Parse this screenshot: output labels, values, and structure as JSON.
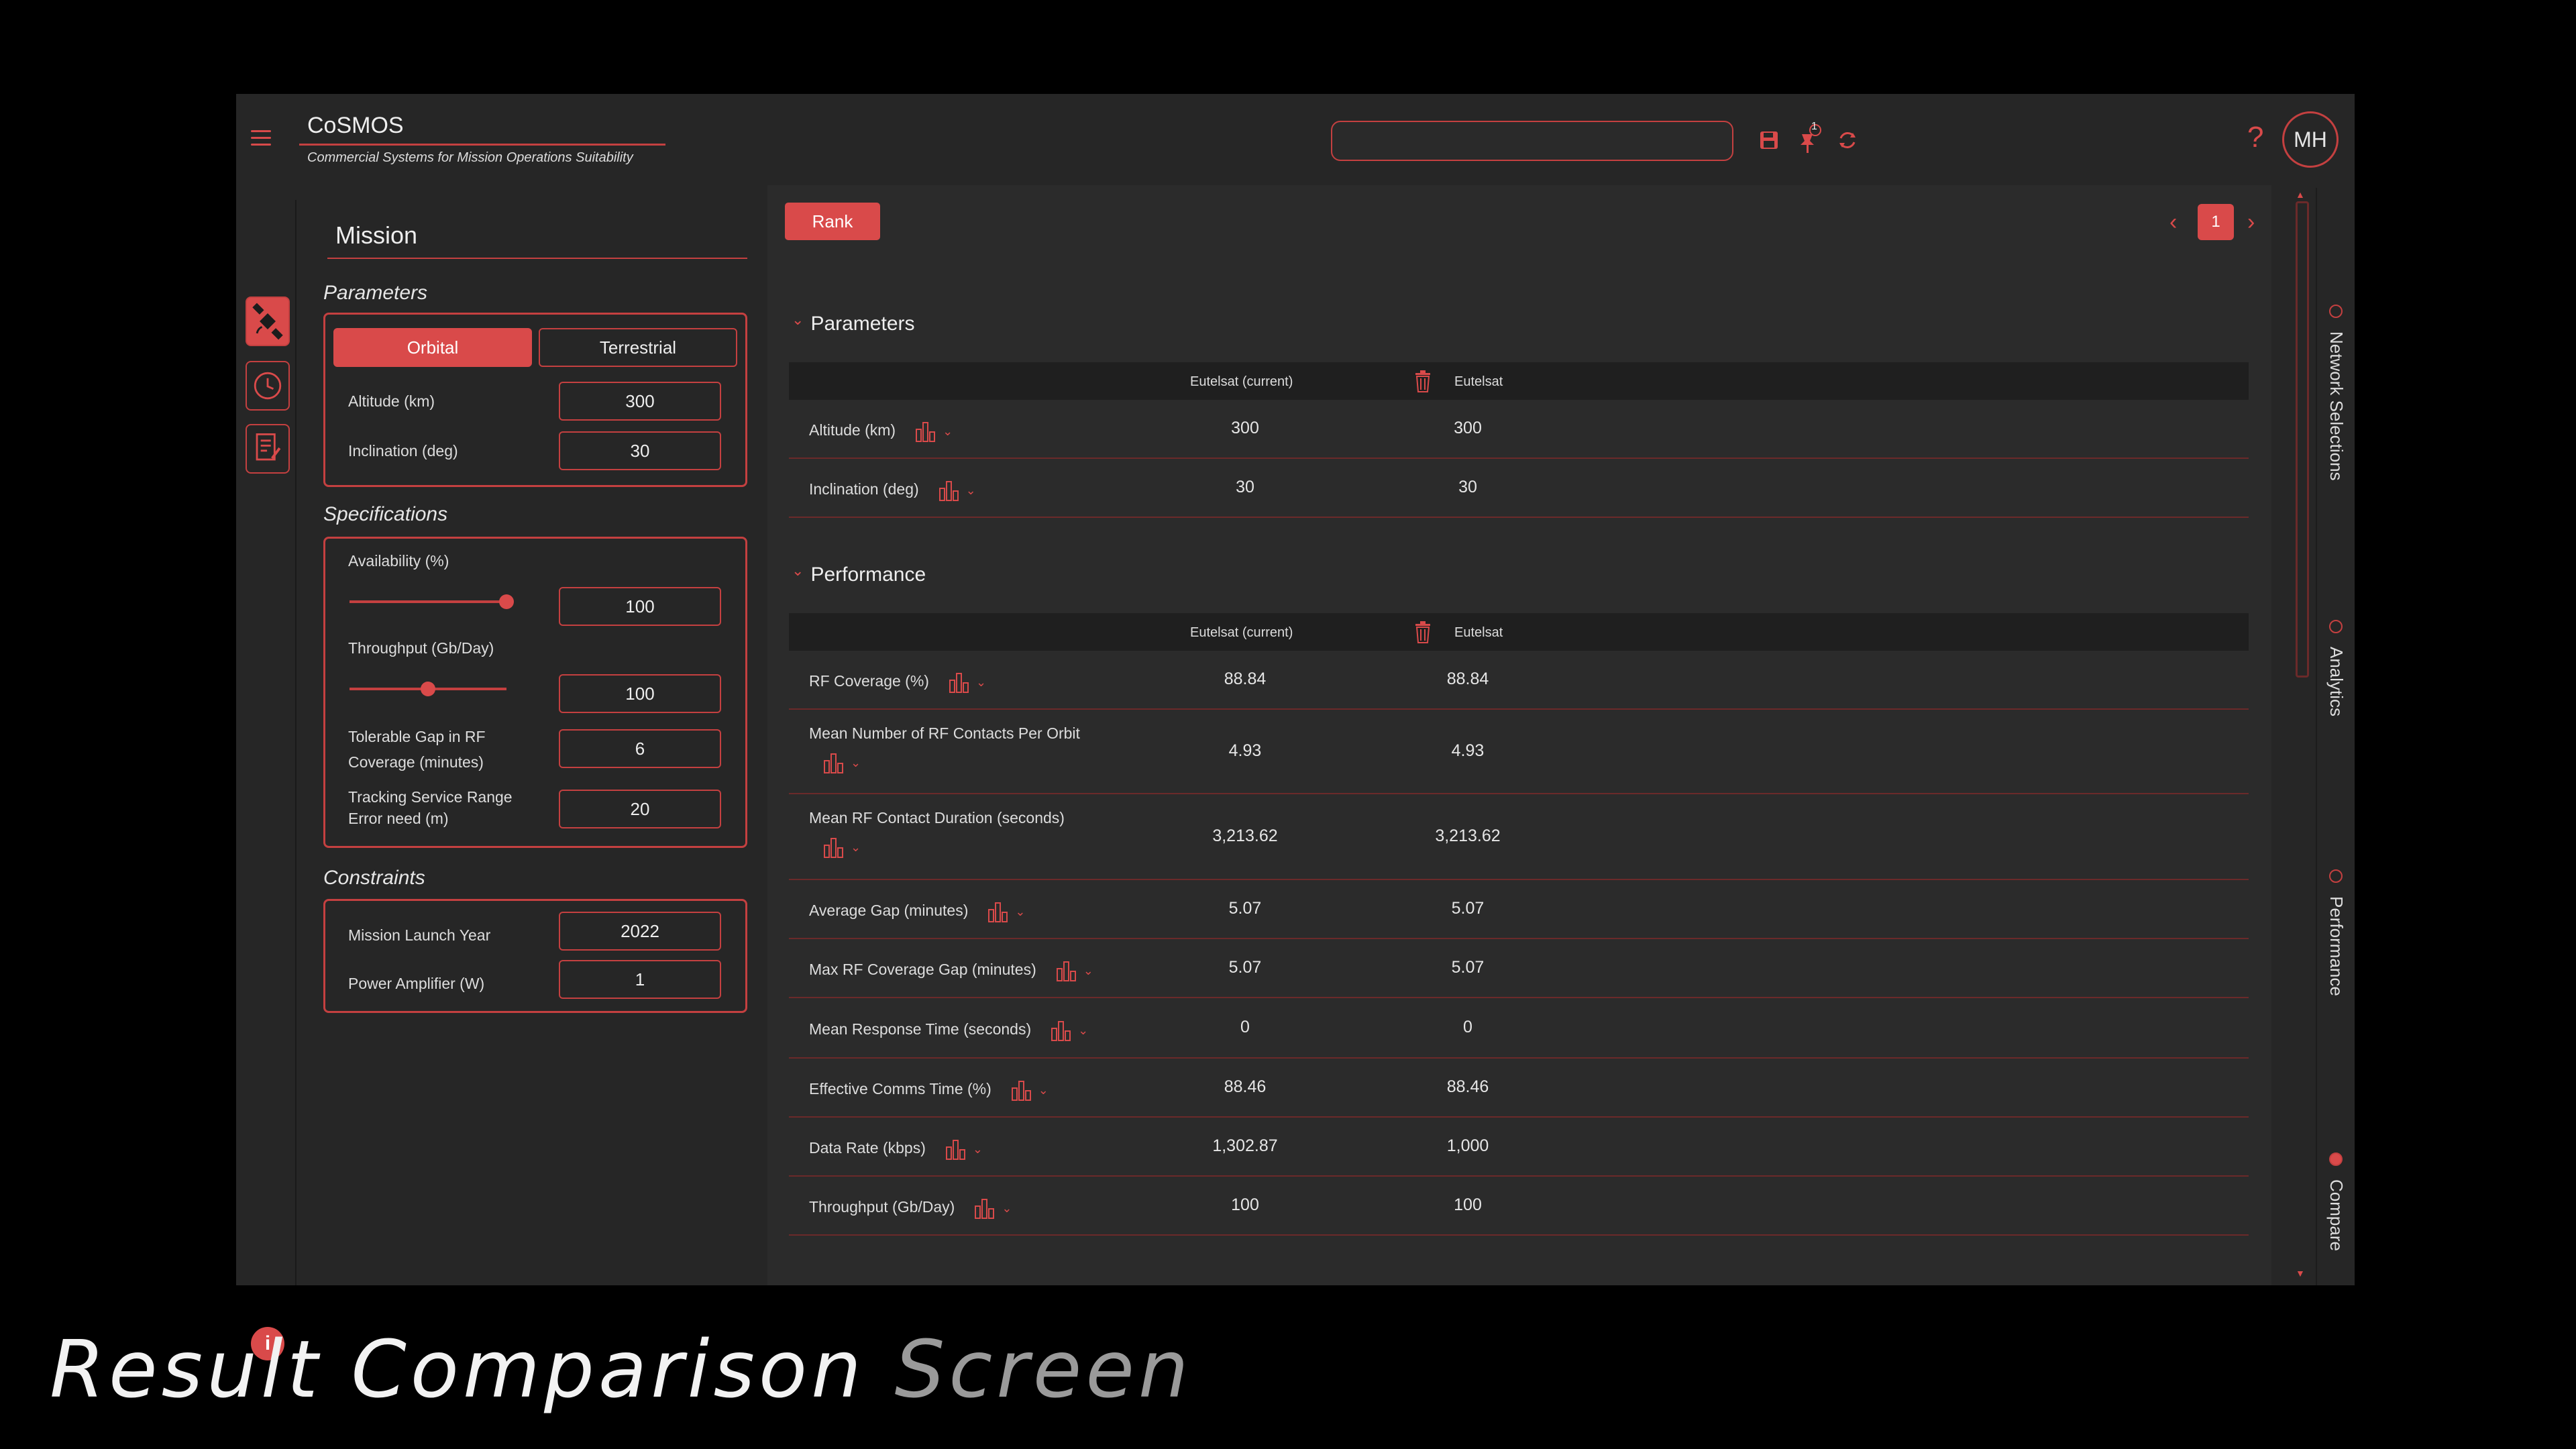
{
  "app": {
    "title": "CoSMOS",
    "subtitle": "Commercial Systems for Mission Operations Suitability",
    "user_initials": "MH",
    "notification_count": "1",
    "help": "?",
    "info": "i"
  },
  "left_panel": {
    "title": "Mission",
    "parameters": {
      "heading": "Parameters",
      "mode_orbital": "Orbital",
      "mode_terrestrial": "Terrestrial",
      "altitude_label": "Altitude (km)",
      "altitude_value": "300",
      "inclination_label": "Inclination (deg)",
      "inclination_value": "30"
    },
    "specifications": {
      "heading": "Specifications",
      "availability_label": "Availability (%)",
      "availability_value": "100",
      "availability_level": 1.0,
      "throughput_label": "Throughput (Gb/Day)",
      "throughput_value": "100",
      "throughput_level": 0.5,
      "gap_label_1": "Tolerable Gap in RF",
      "gap_label_2": "Coverage (minutes)",
      "gap_value": "6",
      "tracking_label_1": "Tracking Service Range",
      "tracking_label_2": "Error need (m)",
      "tracking_value": "20"
    },
    "constraints": {
      "heading": "Constraints",
      "launch_label": "Mission Launch Year",
      "launch_value": "2022",
      "power_label": "Power Amplifier (W)",
      "power_value": "1"
    }
  },
  "main": {
    "rank_label": "Rank",
    "page": "1",
    "prev": "‹",
    "next": "›",
    "col1": "Eutelsat (current)",
    "col2": "Eutelsat",
    "parameters": {
      "heading": "Parameters",
      "rows": [
        {
          "label": "Altitude (km)",
          "v1": "300",
          "v2": "300"
        },
        {
          "label": "Inclination (deg)",
          "v1": "30",
          "v2": "30"
        }
      ]
    },
    "performance": {
      "heading": "Performance",
      "rows": [
        {
          "label": "RF Coverage (%)",
          "v1": "88.84",
          "v2": "88.84"
        },
        {
          "label": "Mean Number of RF Contacts Per Orbit",
          "v1": "4.93",
          "v2": "4.93"
        },
        {
          "label": "Mean RF Contact Duration (seconds)",
          "v1": "3,213.62",
          "v2": "3,213.62"
        },
        {
          "label": "Average Gap (minutes)",
          "v1": "5.07",
          "v2": "5.07"
        },
        {
          "label": "Max RF Coverage Gap (minutes)",
          "v1": "5.07",
          "v2": "5.07"
        },
        {
          "label": "Mean Response Time (seconds)",
          "v1": "0",
          "v2": "0"
        },
        {
          "label": "Effective Comms Time (%)",
          "v1": "88.46",
          "v2": "88.46"
        },
        {
          "label": "Data Rate (kbps)",
          "v1": "1,302.87",
          "v2": "1,000"
        },
        {
          "label": "Throughput (Gb/Day)",
          "v1": "100",
          "v2": "100"
        }
      ]
    }
  },
  "right_nav": {
    "items": [
      "Network Selections",
      "Analytics",
      "Performance",
      "Compare"
    ],
    "active": "Compare"
  },
  "caption": {
    "part1": "Result Comparison",
    "part2": "Screen"
  },
  "colors": {
    "accent": "#d94a4a",
    "background": "#262626",
    "panel": "#2b2b2b"
  }
}
